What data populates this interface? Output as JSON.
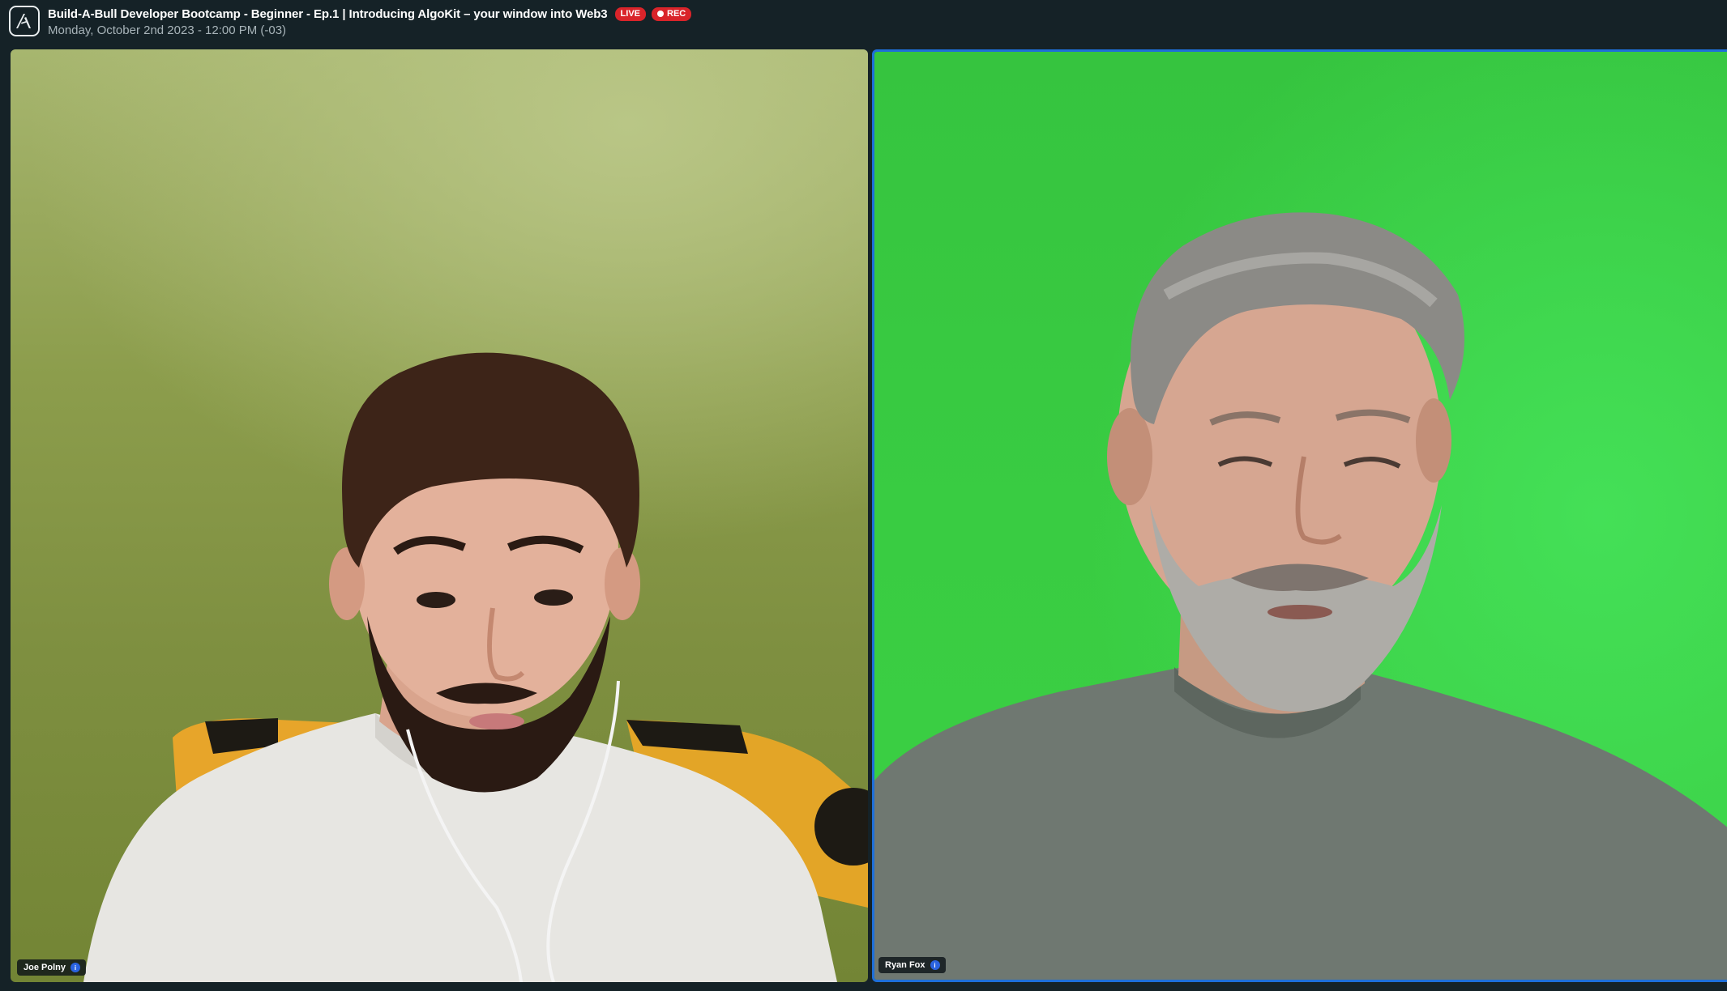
{
  "header": {
    "title": "Build-A-Bull Developer Bootcamp - Beginner - Ep.1 | Introducing AlgoKit – your window into Web3",
    "live_label": "LIVE",
    "rec_label": "REC",
    "subtitle": "Monday, October 2nd 2023 - 12:00 PM (-03)",
    "logo_icon": "algorand-logo-icon"
  },
  "participants": [
    {
      "name": "Joe Polny",
      "badge_icon": "info-icon",
      "badge_text": "i",
      "active_speaker": false
    },
    {
      "name": "Ryan Fox",
      "badge_icon": "info-icon",
      "badge_text": "i",
      "active_speaker": true
    }
  ],
  "colors": {
    "background": "#152227",
    "live_badge": "#d9242a",
    "active_border": "#1e6fd9",
    "info_badge": "#2a63e0"
  }
}
